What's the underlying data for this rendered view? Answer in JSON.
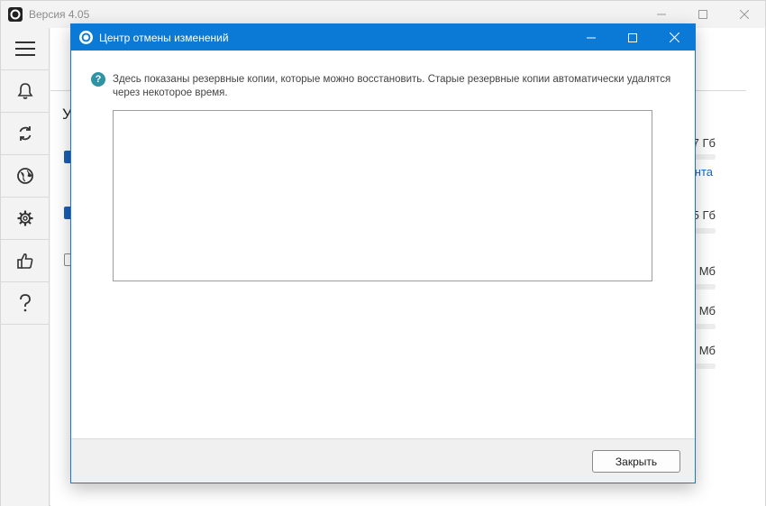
{
  "main_window": {
    "title": "Версия 4.05",
    "controls": {
      "minimize_icon": "minimize-icon",
      "maximize_icon": "maximize-icon",
      "close_icon": "close-icon"
    },
    "sidebar": {
      "items": [
        {
          "name": "menu",
          "icon": "hamburger-icon"
        },
        {
          "name": "notifications",
          "icon": "bell-icon"
        },
        {
          "name": "update",
          "icon": "refresh-icon"
        },
        {
          "name": "privacy",
          "icon": "globe-icon"
        },
        {
          "name": "settings",
          "icon": "gear-icon"
        },
        {
          "name": "rate",
          "icon": "thumbs-up-icon"
        },
        {
          "name": "help",
          "icon": "question-icon"
        }
      ]
    },
    "content": {
      "section_letter": "У",
      "partial_values": [
        "7 Гб",
        "нта",
        "5 Гб",
        "Мб",
        "Мб",
        "Мб"
      ]
    }
  },
  "dialog": {
    "title": "Центр отмены изменений",
    "info_text": "Здесь показаны резервные копии, которые можно восстановить. Старые резервные копии автоматически удалятся через некоторое время.",
    "help_icon_glyph": "?",
    "backup_list_items": [],
    "close_button_label": "Закрыть",
    "accent_color": "#0a7ad6"
  }
}
